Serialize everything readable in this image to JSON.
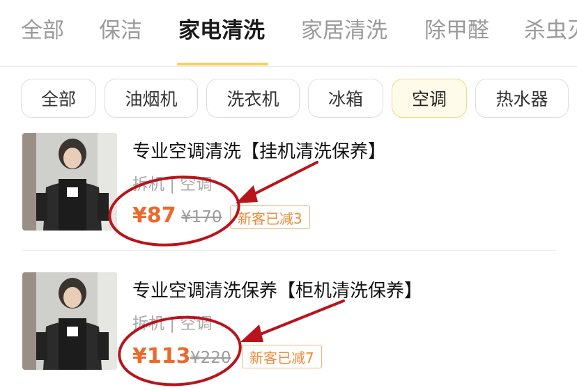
{
  "tabs": [
    "全部",
    "保洁",
    "家电清洗",
    "家居清洗",
    "除甲醛",
    "杀虫灭"
  ],
  "active_tab": "家电清洗",
  "chips": [
    "全部",
    "油烟机",
    "洗衣机",
    "冰箱",
    "空调",
    "热水器"
  ],
  "active_chip": "空调",
  "products": [
    {
      "title": "专业空调清洗【挂机清洗保养】",
      "tags": "拆机 | 空调",
      "price": "¥87",
      "original_price": "¥170",
      "badge": "新客已减3"
    },
    {
      "title": "专业空调清洗保养【柜机清洗保养】",
      "tags": "拆机 | 空调",
      "price": "¥113",
      "original_price": "¥220",
      "badge": "新客已减7"
    }
  ],
  "colors": {
    "accent": "#f3cf5e",
    "price": "#e96a2c",
    "annotation": "#b8141b",
    "badge_border": "#f1b47c"
  }
}
